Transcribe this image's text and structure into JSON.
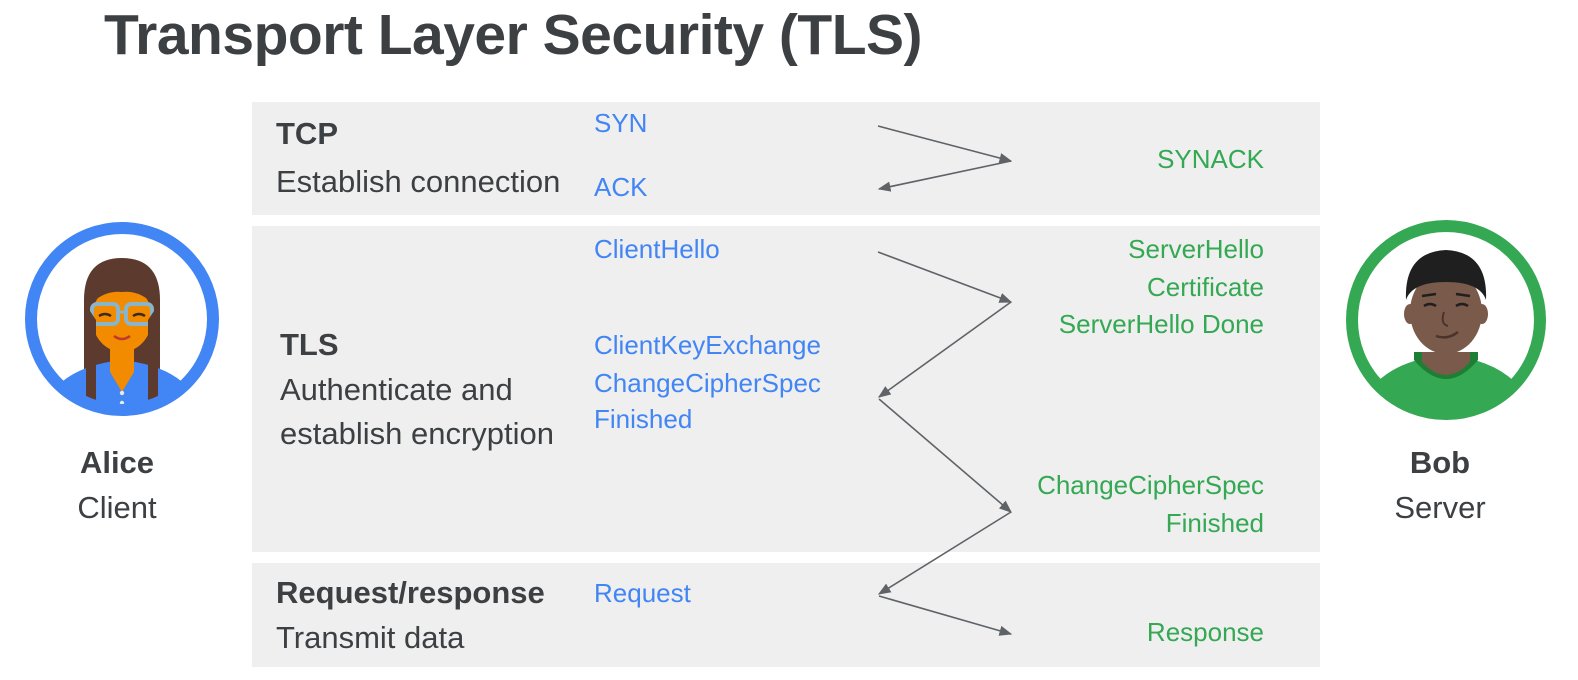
{
  "title": "Transport Layer Security (TLS)",
  "client": {
    "name": "Alice",
    "role": "Client",
    "ring_color": "#4285f4"
  },
  "server": {
    "name": "Bob",
    "role": "Server",
    "ring_color": "#34a853"
  },
  "phases": {
    "tcp": {
      "name": "TCP",
      "description": "Establish connection",
      "client_messages": [
        "SYN",
        "ACK"
      ],
      "server_messages": [
        "SYNACK"
      ]
    },
    "tls": {
      "name": "TLS",
      "description_lines": [
        "Authenticate and",
        "establish encryption"
      ],
      "client_messages": [
        "ClientHello",
        "ClientKeyExchange",
        "ChangeCipherSpec",
        "Finished"
      ],
      "server_messages_1": [
        "ServerHello",
        "Certificate",
        "ServerHello Done"
      ],
      "server_messages_2": [
        "ChangeCipherSpec",
        "Finished"
      ]
    },
    "request": {
      "name": "Request/response",
      "description": "Transmit data",
      "client_messages": [
        "Request"
      ],
      "server_messages": [
        "Response"
      ]
    }
  },
  "colors": {
    "client_text": "#4285f4",
    "server_text": "#34a853",
    "band": "#efefef",
    "arrow": "#5f6368",
    "text": "#3c4043"
  }
}
